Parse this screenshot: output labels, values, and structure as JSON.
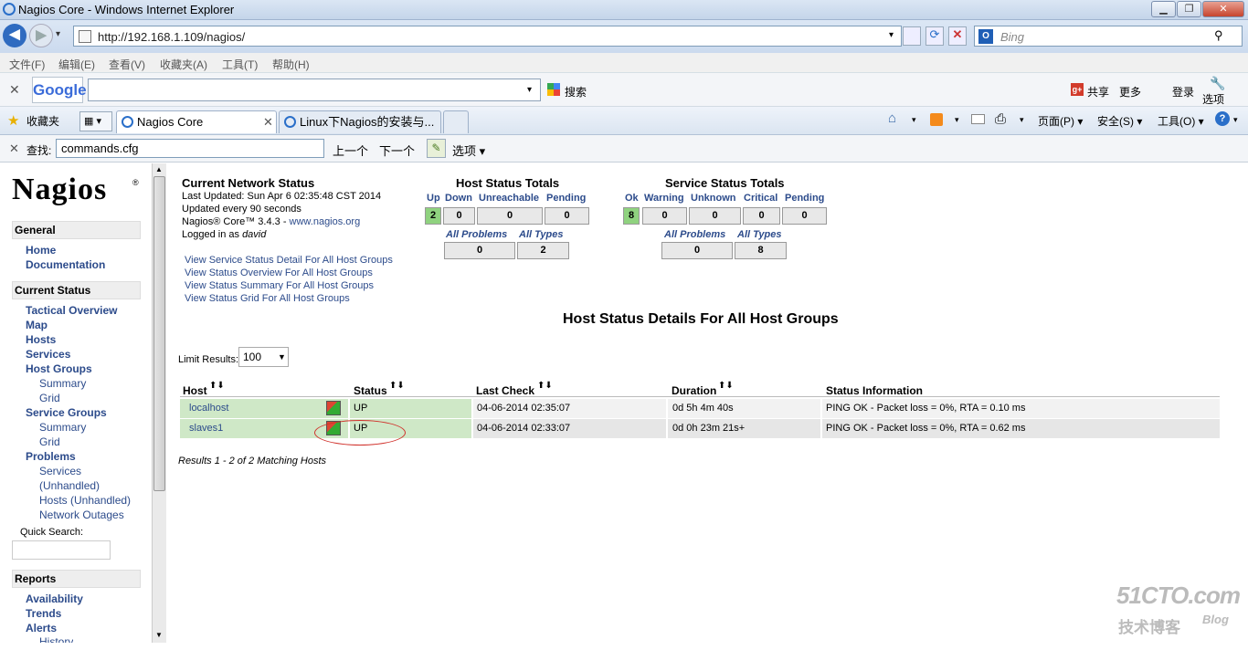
{
  "window": {
    "title": "Nagios Core - Windows Internet Explorer"
  },
  "address": {
    "url": "http://192.168.1.109/nagios/",
    "search_placeholder": "Bing"
  },
  "menu": [
    "文件(F)",
    "编辑(E)",
    "查看(V)",
    "收藏夹(A)",
    "工具(T)",
    "帮助(H)"
  ],
  "google_toolbar": {
    "logo": "Google",
    "search_btn": "搜索",
    "share": "共享",
    "more": "更多",
    "login": "登录",
    "options": "选项"
  },
  "favorites": {
    "label": "收藏夹"
  },
  "tabs": [
    {
      "label": "Nagios Core"
    },
    {
      "label": "Linux下Nagios的安装与..."
    }
  ],
  "command_bar": {
    "page": "页面(P)",
    "safety": "安全(S)",
    "tools": "工具(O)"
  },
  "find": {
    "label": "查找:",
    "value": "commands.cfg",
    "prev": "上一个",
    "next": "下一个",
    "options": "选项"
  },
  "sidebar": {
    "logo": "Nagios",
    "general": {
      "title": "General",
      "items": [
        "Home",
        "Documentation"
      ]
    },
    "current_status": {
      "title": "Current Status",
      "items": [
        "Tactical Overview",
        "Map",
        "Hosts",
        "Services",
        "Host Groups",
        "Summary",
        "Grid",
        "Service Groups",
        "Summary",
        "Grid",
        "Problems",
        "Services",
        "(Unhandled)",
        "Hosts (Unhandled)",
        "Network Outages"
      ]
    },
    "quick_search": "Quick Search:",
    "reports": {
      "title": "Reports",
      "items": [
        "Availability",
        "Trends",
        "Alerts",
        "History"
      ]
    }
  },
  "status": {
    "title": "Current Network Status",
    "updated": "Last Updated: Sun Apr 6 02:35:48 CST 2014",
    "every": "Updated every 90 seconds",
    "version": "Nagios® Core™ 3.4.3 - ",
    "version_link": "www.nagios.org",
    "logged": "Logged in as ",
    "user": "david",
    "links": [
      "View Service Status Detail For All Host Groups",
      "View Status Overview For All Host Groups",
      "View Status Summary For All Host Groups",
      "View Status Grid For All Host Groups"
    ]
  },
  "host_totals": {
    "title": "Host Status Totals",
    "labels": [
      "Up",
      "Down",
      "Unreachable",
      "Pending"
    ],
    "values": [
      "2",
      "0",
      "0",
      "0"
    ],
    "labels2": [
      "All Problems",
      "All Types"
    ],
    "values2": [
      "0",
      "2"
    ]
  },
  "service_totals": {
    "title": "Service Status Totals",
    "labels": [
      "Ok",
      "Warning",
      "Unknown",
      "Critical",
      "Pending"
    ],
    "values": [
      "8",
      "0",
      "0",
      "0",
      "0"
    ],
    "labels2": [
      "All Problems",
      "All Types"
    ],
    "values2": [
      "0",
      "8"
    ]
  },
  "details": {
    "title": "Host Status Details For All Host Groups",
    "limit_label": "Limit Results:",
    "limit_value": "100",
    "columns": [
      "Host",
      "Status",
      "Last Check",
      "Duration",
      "Status Information"
    ],
    "rows": [
      {
        "host": "localhost",
        "status": "UP",
        "last_check": "04-06-2014 02:35:07",
        "duration": "0d 5h 4m 40s",
        "info": "PING OK - Packet loss = 0%, RTA = 0.10 ms"
      },
      {
        "host": "slaves1",
        "status": "UP",
        "last_check": "04-06-2014 02:33:07",
        "duration": "0d 0h 23m 21s+",
        "info": "PING OK - Packet loss = 0%, RTA = 0.62 ms"
      }
    ],
    "results": "Results 1 - 2 of 2 Matching Hosts"
  },
  "watermark": {
    "site": "51CTO.com",
    "sub": "技术博客",
    "blog": "Blog"
  }
}
